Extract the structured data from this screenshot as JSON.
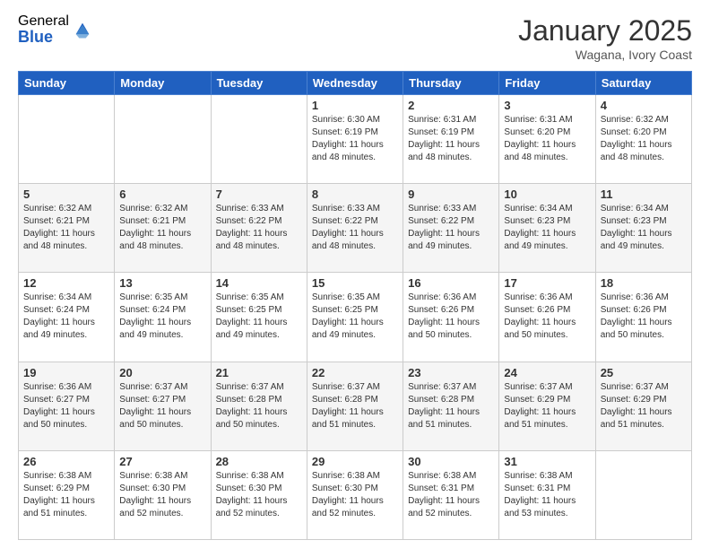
{
  "logo": {
    "general": "General",
    "blue": "Blue"
  },
  "header": {
    "month": "January 2025",
    "location": "Wagana, Ivory Coast"
  },
  "days_of_week": [
    "Sunday",
    "Monday",
    "Tuesday",
    "Wednesday",
    "Thursday",
    "Friday",
    "Saturday"
  ],
  "weeks": [
    [
      {
        "day": "",
        "sunrise": "",
        "sunset": "",
        "daylight": ""
      },
      {
        "day": "",
        "sunrise": "",
        "sunset": "",
        "daylight": ""
      },
      {
        "day": "",
        "sunrise": "",
        "sunset": "",
        "daylight": ""
      },
      {
        "day": "1",
        "sunrise": "6:30 AM",
        "sunset": "6:19 PM",
        "daylight": "11 hours and 48 minutes."
      },
      {
        "day": "2",
        "sunrise": "6:31 AM",
        "sunset": "6:19 PM",
        "daylight": "11 hours and 48 minutes."
      },
      {
        "day": "3",
        "sunrise": "6:31 AM",
        "sunset": "6:20 PM",
        "daylight": "11 hours and 48 minutes."
      },
      {
        "day": "4",
        "sunrise": "6:32 AM",
        "sunset": "6:20 PM",
        "daylight": "11 hours and 48 minutes."
      }
    ],
    [
      {
        "day": "5",
        "sunrise": "6:32 AM",
        "sunset": "6:21 PM",
        "daylight": "11 hours and 48 minutes."
      },
      {
        "day": "6",
        "sunrise": "6:32 AM",
        "sunset": "6:21 PM",
        "daylight": "11 hours and 48 minutes."
      },
      {
        "day": "7",
        "sunrise": "6:33 AM",
        "sunset": "6:22 PM",
        "daylight": "11 hours and 48 minutes."
      },
      {
        "day": "8",
        "sunrise": "6:33 AM",
        "sunset": "6:22 PM",
        "daylight": "11 hours and 48 minutes."
      },
      {
        "day": "9",
        "sunrise": "6:33 AM",
        "sunset": "6:22 PM",
        "daylight": "11 hours and 49 minutes."
      },
      {
        "day": "10",
        "sunrise": "6:34 AM",
        "sunset": "6:23 PM",
        "daylight": "11 hours and 49 minutes."
      },
      {
        "day": "11",
        "sunrise": "6:34 AM",
        "sunset": "6:23 PM",
        "daylight": "11 hours and 49 minutes."
      }
    ],
    [
      {
        "day": "12",
        "sunrise": "6:34 AM",
        "sunset": "6:24 PM",
        "daylight": "11 hours and 49 minutes."
      },
      {
        "day": "13",
        "sunrise": "6:35 AM",
        "sunset": "6:24 PM",
        "daylight": "11 hours and 49 minutes."
      },
      {
        "day": "14",
        "sunrise": "6:35 AM",
        "sunset": "6:25 PM",
        "daylight": "11 hours and 49 minutes."
      },
      {
        "day": "15",
        "sunrise": "6:35 AM",
        "sunset": "6:25 PM",
        "daylight": "11 hours and 49 minutes."
      },
      {
        "day": "16",
        "sunrise": "6:36 AM",
        "sunset": "6:26 PM",
        "daylight": "11 hours and 50 minutes."
      },
      {
        "day": "17",
        "sunrise": "6:36 AM",
        "sunset": "6:26 PM",
        "daylight": "11 hours and 50 minutes."
      },
      {
        "day": "18",
        "sunrise": "6:36 AM",
        "sunset": "6:26 PM",
        "daylight": "11 hours and 50 minutes."
      }
    ],
    [
      {
        "day": "19",
        "sunrise": "6:36 AM",
        "sunset": "6:27 PM",
        "daylight": "11 hours and 50 minutes."
      },
      {
        "day": "20",
        "sunrise": "6:37 AM",
        "sunset": "6:27 PM",
        "daylight": "11 hours and 50 minutes."
      },
      {
        "day": "21",
        "sunrise": "6:37 AM",
        "sunset": "6:28 PM",
        "daylight": "11 hours and 50 minutes."
      },
      {
        "day": "22",
        "sunrise": "6:37 AM",
        "sunset": "6:28 PM",
        "daylight": "11 hours and 51 minutes."
      },
      {
        "day": "23",
        "sunrise": "6:37 AM",
        "sunset": "6:28 PM",
        "daylight": "11 hours and 51 minutes."
      },
      {
        "day": "24",
        "sunrise": "6:37 AM",
        "sunset": "6:29 PM",
        "daylight": "11 hours and 51 minutes."
      },
      {
        "day": "25",
        "sunrise": "6:37 AM",
        "sunset": "6:29 PM",
        "daylight": "11 hours and 51 minutes."
      }
    ],
    [
      {
        "day": "26",
        "sunrise": "6:38 AM",
        "sunset": "6:29 PM",
        "daylight": "11 hours and 51 minutes."
      },
      {
        "day": "27",
        "sunrise": "6:38 AM",
        "sunset": "6:30 PM",
        "daylight": "11 hours and 52 minutes."
      },
      {
        "day": "28",
        "sunrise": "6:38 AM",
        "sunset": "6:30 PM",
        "daylight": "11 hours and 52 minutes."
      },
      {
        "day": "29",
        "sunrise": "6:38 AM",
        "sunset": "6:30 PM",
        "daylight": "11 hours and 52 minutes."
      },
      {
        "day": "30",
        "sunrise": "6:38 AM",
        "sunset": "6:31 PM",
        "daylight": "11 hours and 52 minutes."
      },
      {
        "day": "31",
        "sunrise": "6:38 AM",
        "sunset": "6:31 PM",
        "daylight": "11 hours and 53 minutes."
      },
      {
        "day": "",
        "sunrise": "",
        "sunset": "",
        "daylight": ""
      }
    ]
  ],
  "labels": {
    "sunrise": "Sunrise:",
    "sunset": "Sunset:",
    "daylight": "Daylight:"
  }
}
